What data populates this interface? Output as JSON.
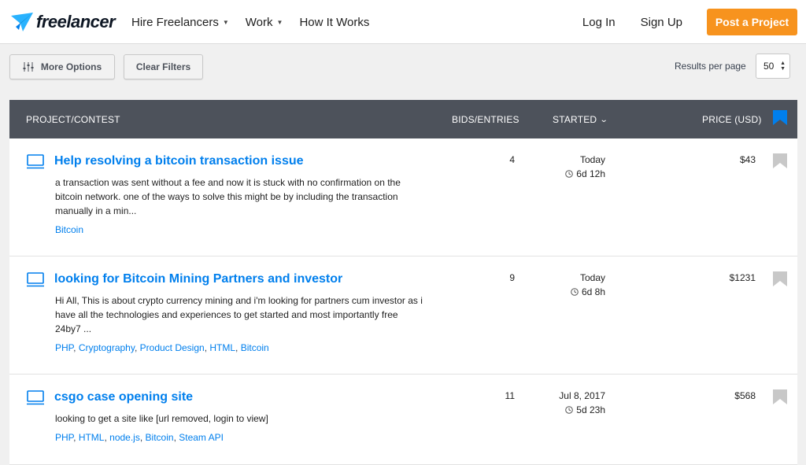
{
  "header": {
    "logo_text": "freelancer",
    "nav": [
      {
        "label": "Hire Freelancers",
        "dropdown": true
      },
      {
        "label": "Work",
        "dropdown": true
      },
      {
        "label": "How It Works",
        "dropdown": false
      }
    ],
    "login": "Log In",
    "signup": "Sign Up",
    "post_button": "Post a Project"
  },
  "filters": {
    "more_options": "More Options",
    "clear_filters": "Clear Filters",
    "results_per_page_label": "Results per page",
    "results_per_page_value": "50"
  },
  "table": {
    "columns": {
      "project": "PROJECT/CONTEST",
      "bids": "BIDS/ENTRIES",
      "started": "STARTED",
      "price": "PRICE (USD)"
    },
    "rows": [
      {
        "title": "Help resolving a bitcoin transaction issue",
        "description": "a transaction was sent without a fee and now it is stuck with no confirmation on the bitcoin network. one of the ways to solve this might be by including the transaction manually in a min...",
        "tags": [
          "Bitcoin"
        ],
        "bids": "4",
        "started": "Today",
        "remaining": "6d 12h",
        "price": "$43"
      },
      {
        "title": "looking for Bitcoin Mining Partners and investor",
        "description": "Hi All, This is about crypto currency mining and i'm looking for partners cum investor as i have all the technologies and experiences to get started and most importantly free 24by7 ...",
        "tags": [
          "PHP",
          "Cryptography",
          "Product Design",
          "HTML",
          "Bitcoin"
        ],
        "bids": "9",
        "started": "Today",
        "remaining": "6d 8h",
        "price": "$1231"
      },
      {
        "title": "csgo case opening site",
        "description": "looking to get a site like [url removed, login to view]",
        "tags": [
          "PHP",
          "HTML",
          "node.js",
          "Bitcoin",
          "Steam API"
        ],
        "bids": "11",
        "started": "Jul 8, 2017",
        "remaining": "5d 23h",
        "price": "$568"
      }
    ]
  },
  "colors": {
    "brand_blue": "#007fed",
    "post_orange": "#f7931e",
    "header_dark": "#4d525b"
  }
}
